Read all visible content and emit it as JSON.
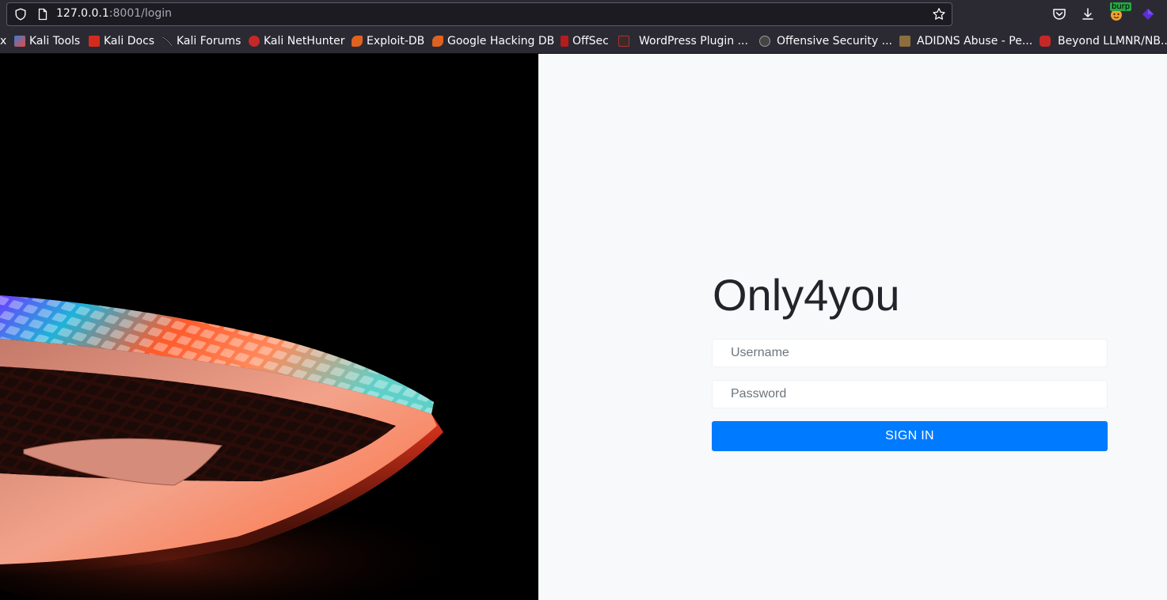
{
  "browser": {
    "url_host": "127.0.0.1",
    "url_rest": ":8001/login",
    "toolbar_icons": [
      "pocket-icon",
      "download-icon",
      "burp-extension-icon",
      "extension-icon"
    ],
    "burp_badge": "burp"
  },
  "bookmarks": [
    {
      "label": "x",
      "icon": "none"
    },
    {
      "label": "Kali Tools",
      "icon": "kali-tools-icon"
    },
    {
      "label": "Kali Docs",
      "icon": "kali-docs-icon"
    },
    {
      "label": "Kali Forums",
      "icon": "kali-forums-icon"
    },
    {
      "label": "Kali NetHunter",
      "icon": "kali-nethunter-icon"
    },
    {
      "label": "Exploit-DB",
      "icon": "exploit-db-icon"
    },
    {
      "label": "Google Hacking DB",
      "icon": "ghdb-icon"
    },
    {
      "label": "OffSec",
      "icon": "offsec-icon"
    },
    {
      "label": "WordPress Plugin ...",
      "icon": "wordpress-plugin-icon"
    },
    {
      "label": "Offensive Security ...",
      "icon": "offensive-security-icon"
    },
    {
      "label": "ADIDNS Abuse - Pe...",
      "icon": "adidns-icon"
    },
    {
      "label": "Beyond LLMNR/NB...",
      "icon": "beyond-llmnr-icon"
    }
  ],
  "login": {
    "title": "Only4you",
    "username_placeholder": "Username",
    "username_value": "",
    "password_placeholder": "Password",
    "password_value": "",
    "submit_label": "SIGN IN"
  },
  "colors": {
    "accent": "#007bff",
    "page_bg": "#f8f9fa",
    "chrome_bg": "#2b2a33",
    "hero_bg": "#000000"
  }
}
